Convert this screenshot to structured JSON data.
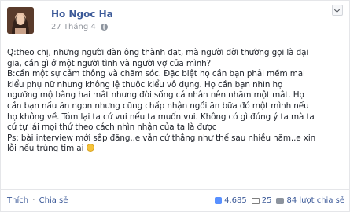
{
  "post": {
    "author": "Ho Ngoc Ha",
    "date": "27 Tháng 4",
    "lines": [
      "Q:theo chị, những người đàn ông thành đạt, mà người đời thường gọi là đại",
      "gia, cần gì ở một người tình và người vợ của mình?",
      "B:cần một sự cảm thông và chăm sóc. Đặc biệt họ cần bạn phải mềm mại",
      "kiểu phụ nữ nhưng không lệ thuộc kiểu vô dụng. Họ cần bạn nhìn họ",
      "ngưỡng mộ bằng hai mắt nhưng đời sống cá nhân nên nhắm một mắt. Họ",
      "cần bạn nấu ăn ngon nhưng cũng chấp nhận ngồi ăn bữa đó một mình nếu",
      "họ không về. Tóm lại ta cứ vui nếu ta muốn vui. Không có gì đúng ý ta mà ta",
      "cứ tự lái mọi thứ theo cách nhìn nhận của ta là được",
      "Ps: bài interview mới sắp đăng..e vẫn cứ thẳng như thế sau nhiều năm..e xin",
      "lỗi nếu trúng tim ai"
    ]
  },
  "footer": {
    "like_label": "Thích",
    "separator": "·",
    "share_label": "Chia sẻ",
    "likes_count": "4.685",
    "shares_count": "25",
    "comments_count": "84 lượt chia sẻ"
  },
  "icons": {
    "options": "chevron-down-icon",
    "audience": "globe-icon",
    "emoji": "smile-emoji-icon",
    "like": "like-icon",
    "share": "share-icon",
    "comment": "comment-icon"
  }
}
